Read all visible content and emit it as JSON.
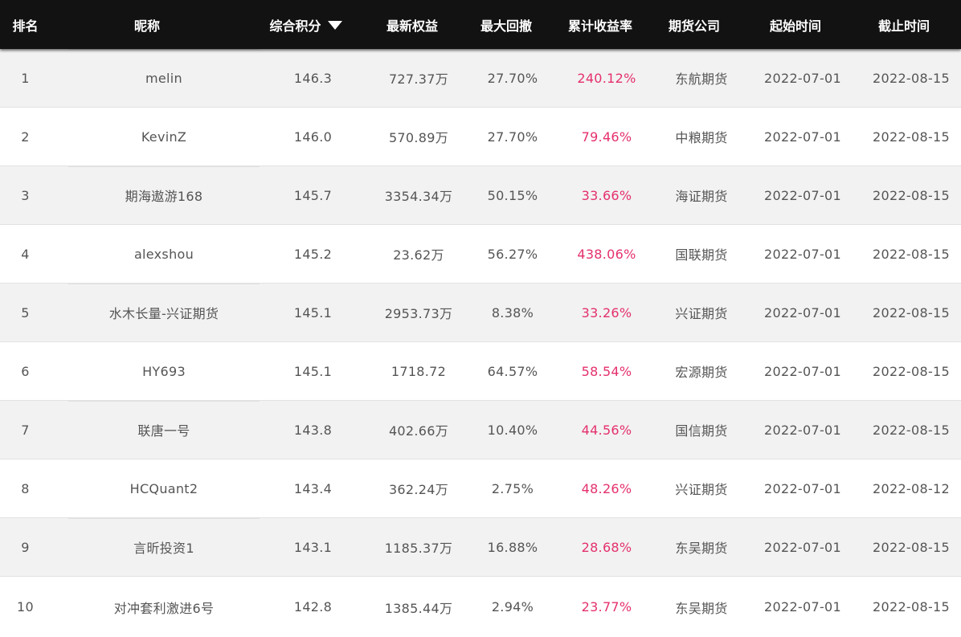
{
  "header": {
    "rank": "排名",
    "nickname": "昵称",
    "score": "综合积分",
    "equity": "最新权益",
    "drawdown": "最大回撤",
    "return": "累计收益率",
    "company": "期货公司",
    "start": "起始时间",
    "end": "截止时间",
    "sort_icon": "caret-down-icon"
  },
  "colors": {
    "header_bg": "#121212",
    "return_text": "#e4306c",
    "row_alt": "#f2f2f2"
  },
  "rows": [
    {
      "rank": "1",
      "nickname": "melin",
      "score": "146.3",
      "equity": "727.37万",
      "drawdown": "27.70%",
      "return": "240.12%",
      "company": "东航期货",
      "start": "2022-07-01",
      "end": "2022-08-15"
    },
    {
      "rank": "2",
      "nickname": "KevinZ",
      "score": "146.0",
      "equity": "570.89万",
      "drawdown": "27.70%",
      "return": "79.46%",
      "company": "中粮期货",
      "start": "2022-07-01",
      "end": "2022-08-15"
    },
    {
      "rank": "3",
      "nickname": "期海遨游168",
      "score": "145.7",
      "equity": "3354.34万",
      "drawdown": "50.15%",
      "return": "33.66%",
      "company": "海证期货",
      "start": "2022-07-01",
      "end": "2022-08-15"
    },
    {
      "rank": "4",
      "nickname": "alexshou",
      "score": "145.2",
      "equity": "23.62万",
      "drawdown": "56.27%",
      "return": "438.06%",
      "company": "国联期货",
      "start": "2022-07-01",
      "end": "2022-08-15"
    },
    {
      "rank": "5",
      "nickname": "水木长量-兴证期货",
      "score": "145.1",
      "equity": "2953.73万",
      "drawdown": "8.38%",
      "return": "33.26%",
      "company": "兴证期货",
      "start": "2022-07-01",
      "end": "2022-08-15"
    },
    {
      "rank": "6",
      "nickname": "HY693",
      "score": "145.1",
      "equity": "1718.72",
      "drawdown": "64.57%",
      "return": "58.54%",
      "company": "宏源期货",
      "start": "2022-07-01",
      "end": "2022-08-15"
    },
    {
      "rank": "7",
      "nickname": "联唐一号",
      "score": "143.8",
      "equity": "402.66万",
      "drawdown": "10.40%",
      "return": "44.56%",
      "company": "国信期货",
      "start": "2022-07-01",
      "end": "2022-08-15"
    },
    {
      "rank": "8",
      "nickname": "HCQuant2",
      "score": "143.4",
      "equity": "362.24万",
      "drawdown": "2.75%",
      "return": "48.26%",
      "company": "兴证期货",
      "start": "2022-07-01",
      "end": "2022-08-12"
    },
    {
      "rank": "9",
      "nickname": "言昕投资1",
      "score": "143.1",
      "equity": "1185.37万",
      "drawdown": "16.88%",
      "return": "28.68%",
      "company": "东吴期货",
      "start": "2022-07-01",
      "end": "2022-08-15"
    },
    {
      "rank": "10",
      "nickname": "对冲套利激进6号",
      "score": "142.8",
      "equity": "1385.44万",
      "drawdown": "2.94%",
      "return": "23.77%",
      "company": "东吴期货",
      "start": "2022-07-01",
      "end": "2022-08-15"
    }
  ]
}
